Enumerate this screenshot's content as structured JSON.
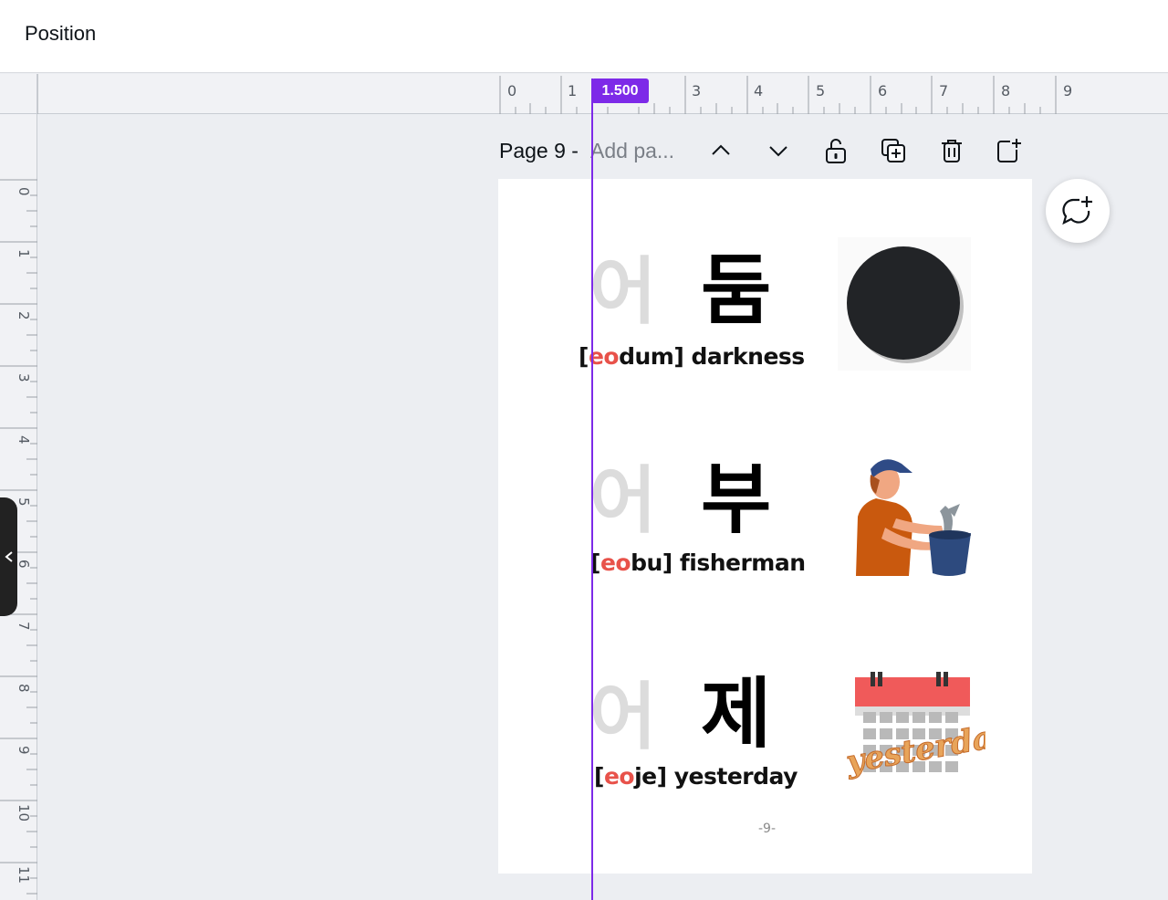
{
  "topbar": {
    "title": "Position"
  },
  "ruler": {
    "h_labels": [
      "0",
      "1",
      "3",
      "4",
      "5",
      "6",
      "7",
      "8",
      "9"
    ],
    "v_labels": [
      "0",
      "1",
      "2",
      "3",
      "4",
      "5",
      "6",
      "7",
      "8",
      "9",
      "10",
      "11"
    ],
    "guide_value": "1.500"
  },
  "page_header": {
    "label": "Page 9 -",
    "title_placeholder": "Add pa...",
    "icons": [
      "chevron-up-icon",
      "chevron-down-icon",
      "unlock-icon",
      "duplicate-icon",
      "trash-icon",
      "add-page-icon"
    ]
  },
  "page": {
    "rows": [
      {
        "ghost": "어",
        "syllable": "둠",
        "caption_open": "[",
        "caption_hl": "eo",
        "caption_rest": "dum] darkness",
        "image": "black-circle"
      },
      {
        "ghost": "어",
        "syllable": "부",
        "caption_open": "[",
        "caption_hl": "eo",
        "caption_rest": "bu] fisherman",
        "image": "fisherman"
      },
      {
        "ghost": "어",
        "syllable": "제",
        "caption_open": "[",
        "caption_hl": "eo",
        "caption_rest": "je] yesterday",
        "image": "calendar-yesterday",
        "image_text": "yesterday"
      }
    ],
    "page_number": "-9-"
  },
  "colors": {
    "accent": "#7d2ae8",
    "highlight": "#e8524a",
    "calendar_red": "#f05a5a",
    "orange": "#e8a45a"
  }
}
